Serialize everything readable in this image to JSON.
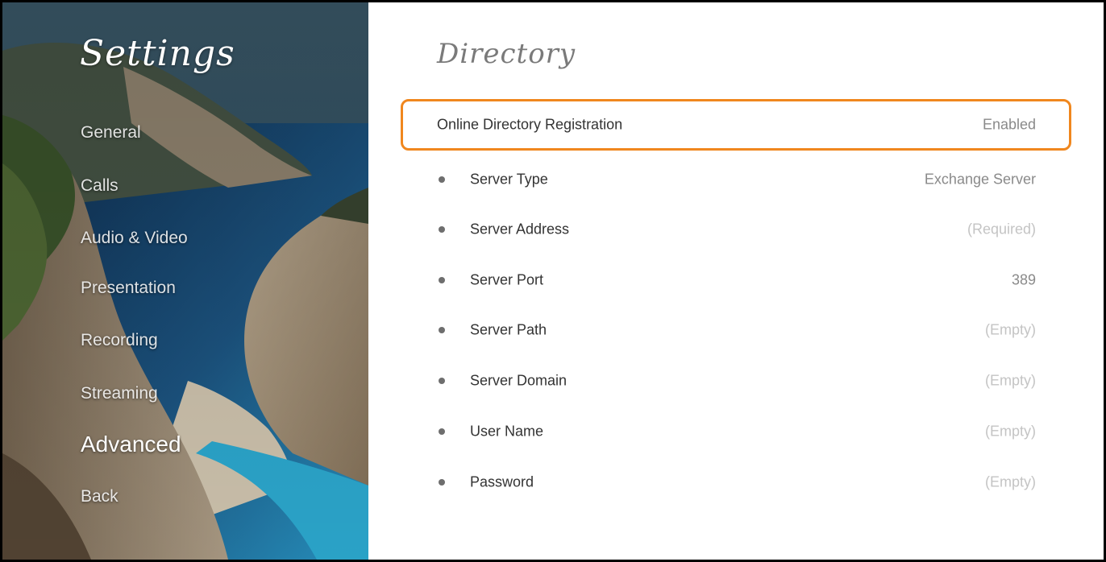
{
  "sidebar": {
    "title": "Settings",
    "items": [
      {
        "label": "General",
        "active": false
      },
      {
        "label": "Calls",
        "active": false
      },
      {
        "label": "Audio & Video",
        "active": false
      },
      {
        "label": "Presentation",
        "active": false
      },
      {
        "label": "Recording",
        "active": false
      },
      {
        "label": "Streaming",
        "active": false
      },
      {
        "label": "Advanced",
        "active": true
      },
      {
        "label": "Back",
        "active": false
      }
    ]
  },
  "main": {
    "title": "Directory",
    "highlight_color": "#f0871e",
    "settings": [
      {
        "label": "Online Directory Registration",
        "value": "Enabled",
        "selected": true
      },
      {
        "label": "Server Type",
        "value": "Exchange Server"
      },
      {
        "label": "Server Address",
        "value": "(Required)"
      },
      {
        "label": "Server Port",
        "value": "389"
      },
      {
        "label": "Server Path",
        "value": "(Empty)"
      },
      {
        "label": "Server Domain",
        "value": "(Empty)"
      },
      {
        "label": "User Name",
        "value": "(Empty)"
      },
      {
        "label": "Password",
        "value": "(Empty)"
      }
    ]
  }
}
